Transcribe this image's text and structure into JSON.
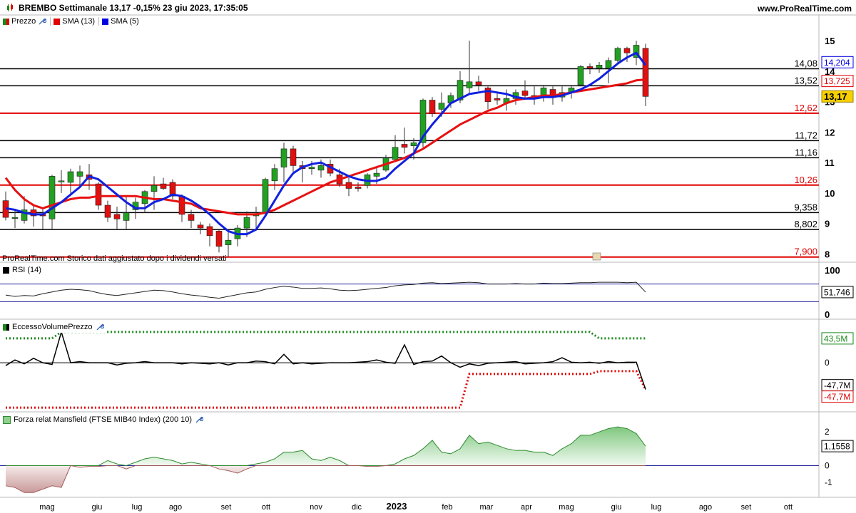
{
  "header": {
    "title": "BREMBO Settimanale 13,17 -0,15% 23 giu 2023, 17:35:05",
    "site": "www.ProRealTime.com"
  },
  "price_panel": {
    "legend": [
      {
        "label": "Prezzo",
        "color": "#1a8a1a"
      },
      {
        "label": "SMA (13)",
        "color": "#e00000"
      },
      {
        "label": "SMA (5)",
        "color": "#0000e0"
      }
    ],
    "caption": "ProRealTime.com  Storico dati aggiustato dopo i dividendi versati",
    "y_ticks": [
      "15",
      "14",
      "13",
      "12",
      "11",
      "10",
      "9",
      "8"
    ],
    "black_levels": [
      "14,08",
      "13,52",
      "11,72",
      "11,16",
      "9,358",
      "8,802"
    ],
    "red_levels": [
      "12,62",
      "10,26",
      "7,900"
    ],
    "sma5_badge": "14,204",
    "sma13_badge": "13,725",
    "last_price_badge": "13,17"
  },
  "rsi_panel": {
    "legend": "RSI (14)",
    "y_ticks": [
      "100",
      "0"
    ],
    "value_badge": "51,746"
  },
  "volume_panel": {
    "legend": "EccessoVolumePrezzo",
    "upper_badge": "43,5M",
    "zero_tick": "0",
    "lower_badge_black": "-47,7M",
    "lower_badge_red": "-47,7M"
  },
  "mansfield_panel": {
    "legend": "Forza relat Mansfield (FTSE MIB40 Index) (200 10)",
    "y_ticks": [
      "2",
      "0",
      "-1"
    ],
    "value_badge": "1,1558"
  },
  "x_axis": {
    "labels": [
      "mag",
      "giu",
      "lug",
      "ago",
      "set",
      "ott",
      "nov",
      "dic",
      "2023",
      "feb",
      "mar",
      "apr",
      "mag",
      "giu",
      "lug",
      "ago",
      "set",
      "ott"
    ]
  },
  "chart_data": {
    "type": "candlestick",
    "title": "BREMBO Settimanale",
    "period": "weekly",
    "candles": [
      {
        "o": 9.75,
        "h": 10.05,
        "l": 9.1,
        "c": 9.2
      },
      {
        "o": 9.2,
        "h": 9.45,
        "l": 8.85,
        "c": 9.2
      },
      {
        "o": 9.1,
        "h": 9.9,
        "l": 9.0,
        "c": 9.45
      },
      {
        "o": 9.45,
        "h": 9.65,
        "l": 8.9,
        "c": 9.25
      },
      {
        "o": 9.3,
        "h": 9.5,
        "l": 8.8,
        "c": 9.25
      },
      {
        "o": 9.15,
        "h": 10.6,
        "l": 8.8,
        "c": 10.55
      },
      {
        "o": 10.4,
        "h": 10.75,
        "l": 10.0,
        "c": 10.4
      },
      {
        "o": 10.35,
        "h": 10.8,
        "l": 9.9,
        "c": 10.7
      },
      {
        "o": 10.55,
        "h": 10.9,
        "l": 10.2,
        "c": 10.7
      },
      {
        "o": 10.6,
        "h": 10.95,
        "l": 10.1,
        "c": 10.45
      },
      {
        "o": 10.3,
        "h": 10.35,
        "l": 9.45,
        "c": 9.6
      },
      {
        "o": 9.6,
        "h": 9.75,
        "l": 9.05,
        "c": 9.2
      },
      {
        "o": 9.3,
        "h": 9.55,
        "l": 8.8,
        "c": 9.15
      },
      {
        "o": 9.1,
        "h": 9.9,
        "l": 8.8,
        "c": 9.35
      },
      {
        "o": 9.45,
        "h": 9.85,
        "l": 9.15,
        "c": 9.7
      },
      {
        "o": 9.65,
        "h": 10.1,
        "l": 9.35,
        "c": 10.05
      },
      {
        "o": 10.05,
        "h": 10.55,
        "l": 9.45,
        "c": 10.25
      },
      {
        "o": 10.3,
        "h": 10.5,
        "l": 10.1,
        "c": 10.15
      },
      {
        "o": 10.35,
        "h": 10.45,
        "l": 9.8,
        "c": 9.9
      },
      {
        "o": 9.9,
        "h": 9.95,
        "l": 9.05,
        "c": 9.3
      },
      {
        "o": 9.3,
        "h": 9.45,
        "l": 8.85,
        "c": 9.1
      },
      {
        "o": 8.95,
        "h": 9.05,
        "l": 8.65,
        "c": 8.85
      },
      {
        "o": 8.9,
        "h": 9.0,
        "l": 8.25,
        "c": 8.6
      },
      {
        "o": 8.75,
        "h": 8.8,
        "l": 8.05,
        "c": 8.25
      },
      {
        "o": 8.3,
        "h": 8.75,
        "l": 7.9,
        "c": 8.45
      },
      {
        "o": 8.5,
        "h": 8.95,
        "l": 8.25,
        "c": 8.85
      },
      {
        "o": 8.85,
        "h": 9.4,
        "l": 8.55,
        "c": 9.2
      },
      {
        "o": 9.25,
        "h": 9.55,
        "l": 8.85,
        "c": 9.3
      },
      {
        "o": 9.35,
        "h": 10.5,
        "l": 9.3,
        "c": 10.45
      },
      {
        "o": 10.4,
        "h": 10.95,
        "l": 10.1,
        "c": 10.8
      },
      {
        "o": 10.85,
        "h": 11.65,
        "l": 10.35,
        "c": 11.45
      },
      {
        "o": 11.45,
        "h": 11.55,
        "l": 10.7,
        "c": 10.9
      },
      {
        "o": 10.9,
        "h": 11.05,
        "l": 10.35,
        "c": 10.8
      },
      {
        "o": 10.8,
        "h": 11.05,
        "l": 10.6,
        "c": 10.85
      },
      {
        "o": 10.75,
        "h": 11.1,
        "l": 10.5,
        "c": 10.9
      },
      {
        "o": 10.95,
        "h": 11.1,
        "l": 10.55,
        "c": 10.65
      },
      {
        "o": 10.6,
        "h": 10.8,
        "l": 10.2,
        "c": 10.3
      },
      {
        "o": 10.35,
        "h": 10.5,
        "l": 9.9,
        "c": 10.15
      },
      {
        "o": 10.2,
        "h": 10.35,
        "l": 10.05,
        "c": 10.15
      },
      {
        "o": 10.25,
        "h": 10.65,
        "l": 10.15,
        "c": 10.6
      },
      {
        "o": 10.55,
        "h": 10.85,
        "l": 10.3,
        "c": 10.65
      },
      {
        "o": 10.75,
        "h": 11.25,
        "l": 10.7,
        "c": 11.15
      },
      {
        "o": 11.1,
        "h": 11.9,
        "l": 11.1,
        "c": 11.5
      },
      {
        "o": 11.6,
        "h": 12.15,
        "l": 11.3,
        "c": 11.5
      },
      {
        "o": 11.55,
        "h": 11.8,
        "l": 11.1,
        "c": 11.65
      },
      {
        "o": 11.65,
        "h": 13.1,
        "l": 11.5,
        "c": 13.05
      },
      {
        "o": 13.05,
        "h": 13.15,
        "l": 12.5,
        "c": 12.6
      },
      {
        "o": 12.75,
        "h": 13.3,
        "l": 12.5,
        "c": 12.95
      },
      {
        "o": 12.95,
        "h": 13.3,
        "l": 12.8,
        "c": 13.2
      },
      {
        "o": 13.05,
        "h": 14.0,
        "l": 12.95,
        "c": 13.7
      },
      {
        "o": 13.45,
        "h": 15.0,
        "l": 13.25,
        "c": 13.65
      },
      {
        "o": 13.65,
        "h": 13.85,
        "l": 13.35,
        "c": 13.55
      },
      {
        "o": 13.45,
        "h": 13.5,
        "l": 12.75,
        "c": 13.0
      },
      {
        "o": 13.1,
        "h": 13.3,
        "l": 12.9,
        "c": 13.05
      },
      {
        "o": 12.95,
        "h": 13.4,
        "l": 12.7,
        "c": 13.1
      },
      {
        "o": 13.1,
        "h": 13.4,
        "l": 12.9,
        "c": 13.3
      },
      {
        "o": 13.35,
        "h": 13.7,
        "l": 13.1,
        "c": 13.2
      },
      {
        "o": 13.2,
        "h": 13.5,
        "l": 12.9,
        "c": 13.1
      },
      {
        "o": 13.15,
        "h": 13.55,
        "l": 13.0,
        "c": 13.45
      },
      {
        "o": 13.4,
        "h": 13.5,
        "l": 12.9,
        "c": 13.15
      },
      {
        "o": 13.15,
        "h": 13.5,
        "l": 13.0,
        "c": 13.3
      },
      {
        "o": 13.3,
        "h": 13.55,
        "l": 13.1,
        "c": 13.45
      },
      {
        "o": 13.55,
        "h": 14.2,
        "l": 13.5,
        "c": 14.15
      },
      {
        "o": 14.15,
        "h": 14.25,
        "l": 13.9,
        "c": 14.1
      },
      {
        "o": 14.1,
        "h": 14.3,
        "l": 13.95,
        "c": 14.2
      },
      {
        "o": 14.1,
        "h": 14.45,
        "l": 13.6,
        "c": 14.35
      },
      {
        "o": 14.35,
        "h": 14.8,
        "l": 14.2,
        "c": 14.75
      },
      {
        "o": 14.75,
        "h": 14.8,
        "l": 14.3,
        "c": 14.6
      },
      {
        "o": 14.45,
        "h": 15.0,
        "l": 14.2,
        "c": 14.85
      },
      {
        "o": 14.75,
        "h": 14.9,
        "l": 12.85,
        "c": 13.17
      }
    ],
    "sma5": [
      9.5,
      9.45,
      9.35,
      9.3,
      9.3,
      9.5,
      9.7,
      9.95,
      10.2,
      10.55,
      10.45,
      10.2,
      9.95,
      9.7,
      9.5,
      9.5,
      9.7,
      9.8,
      9.95,
      9.9,
      9.75,
      9.55,
      9.3,
      9.0,
      8.75,
      8.65,
      8.65,
      8.8,
      9.25,
      9.75,
      10.25,
      10.65,
      10.85,
      10.95,
      11.0,
      10.85,
      10.7,
      10.55,
      10.45,
      10.4,
      10.4,
      10.5,
      10.8,
      11.05,
      11.3,
      11.85,
      12.25,
      12.6,
      12.95,
      13.1,
      13.25,
      13.3,
      13.35,
      13.3,
      13.25,
      13.15,
      13.1,
      13.1,
      13.15,
      13.15,
      13.2,
      13.3,
      13.4,
      13.55,
      13.75,
      14.0,
      14.25,
      14.45,
      14.6,
      14.2
    ],
    "sma13": [
      10.5,
      10.1,
      9.8,
      9.6,
      9.5,
      9.6,
      9.7,
      9.8,
      9.85,
      9.85,
      9.9,
      9.9,
      9.9,
      9.9,
      9.9,
      9.85,
      9.8,
      9.8,
      9.75,
      9.7,
      9.65,
      9.5,
      9.45,
      9.4,
      9.35,
      9.3,
      9.3,
      9.3,
      9.35,
      9.45,
      9.6,
      9.75,
      9.9,
      10.05,
      10.2,
      10.35,
      10.45,
      10.55,
      10.65,
      10.75,
      10.85,
      10.95,
      11.05,
      11.15,
      11.3,
      11.45,
      11.65,
      11.85,
      12.05,
      12.25,
      12.4,
      12.55,
      12.7,
      12.8,
      12.95,
      13.05,
      13.1,
      13.15,
      13.2,
      13.2,
      13.25,
      13.3,
      13.35,
      13.4,
      13.45,
      13.5,
      13.55,
      13.6,
      13.7,
      13.725
    ],
    "levels_black": [
      14.08,
      13.52,
      11.72,
      11.16,
      9.358,
      8.802
    ],
    "levels_red": [
      12.62,
      10.26,
      7.9
    ],
    "y_range": [
      7.8,
      15.4
    ],
    "rsi": {
      "range": [
        0,
        100
      ],
      "bands": [
        70,
        30
      ],
      "values": [
        45,
        42,
        44,
        43,
        48,
        52,
        56,
        58,
        57,
        55,
        50,
        46,
        44,
        47,
        50,
        53,
        56,
        55,
        52,
        48,
        45,
        43,
        40,
        38,
        42,
        46,
        50,
        52,
        58,
        62,
        65,
        63,
        60,
        60,
        61,
        59,
        56,
        55,
        56,
        58,
        60,
        62,
        66,
        68,
        69,
        72,
        73,
        71,
        72,
        73,
        74,
        73,
        70,
        70,
        70,
        71,
        70,
        70,
        72,
        71,
        71,
        72,
        73,
        73,
        74,
        74,
        74,
        73,
        74,
        51.746
      ]
    },
    "volume_excess": {
      "black_line": [
        -5,
        5,
        -2,
        8,
        0,
        -3,
        55,
        0,
        2,
        0,
        0,
        0,
        -4,
        -1,
        0,
        2,
        0,
        0,
        0,
        -2,
        0,
        -1,
        -2,
        0,
        -4,
        0,
        0,
        3,
        2,
        -2,
        15,
        -2,
        0,
        -2,
        -1,
        0,
        0,
        0,
        1,
        2,
        5,
        1,
        -1,
        32,
        -3,
        2,
        3,
        12,
        0,
        -8,
        -2,
        -5,
        -1,
        0,
        1,
        2,
        -2,
        -1,
        0,
        2,
        9,
        1,
        0,
        1,
        -1,
        2,
        0,
        1,
        1,
        -47.7
      ],
      "green_dotted": [
        43.5,
        43.5,
        43.5,
        43.5,
        43.5,
        43.5,
        55,
        55,
        55,
        55,
        55,
        55,
        55,
        55,
        55,
        55,
        55,
        55,
        55,
        55,
        55,
        55,
        55,
        55,
        55,
        55,
        55,
        55,
        55,
        55,
        55,
        55,
        55,
        55,
        55,
        55,
        55,
        55,
        55,
        55,
        55,
        55,
        55,
        55,
        55,
        55,
        55,
        55,
        55,
        55,
        55,
        55,
        55,
        55,
        55,
        55,
        55,
        55,
        55,
        55,
        55,
        55,
        55,
        55,
        43.5,
        43.5,
        43.5,
        43.5,
        43.5,
        43.5
      ],
      "red_dotted": [
        -80,
        -80,
        -80,
        -80,
        -80,
        -80,
        -80,
        -80,
        -80,
        -80,
        -80,
        -80,
        -80,
        -80,
        -80,
        -80,
        -80,
        -80,
        -80,
        -80,
        -80,
        -80,
        -80,
        -80,
        -80,
        -80,
        -80,
        -80,
        -80,
        -80,
        -80,
        -80,
        -80,
        -80,
        -80,
        -80,
        -80,
        -80,
        -80,
        -80,
        -80,
        -80,
        -80,
        -80,
        -80,
        -80,
        -80,
        -80,
        -80,
        -80,
        -20,
        -20,
        -20,
        -20,
        -20,
        -20,
        -20,
        -20,
        -20,
        -20,
        -20,
        -20,
        -20,
        -20,
        -15,
        -15,
        -15,
        -15,
        -15,
        -47.7
      ]
    },
    "mansfield": {
      "values": [
        -1.2,
        -1.3,
        -1.6,
        -1.6,
        -1.4,
        -1.2,
        -1.3,
        0.0,
        -0.1,
        -0.05,
        -0.05,
        0.3,
        0.1,
        -0.2,
        0.2,
        0.4,
        0.5,
        0.4,
        0.3,
        0.1,
        0.2,
        0.1,
        0.0,
        -0.2,
        -0.3,
        -0.45,
        -0.2,
        0.1,
        0.2,
        0.4,
        0.8,
        0.8,
        0.9,
        0.4,
        0.3,
        0.5,
        0.3,
        0.0,
        0.0,
        -0.05,
        -0.05,
        0.0,
        0.1,
        0.4,
        0.6,
        1.0,
        1.5,
        0.8,
        0.7,
        1.0,
        1.8,
        1.3,
        1.4,
        1.2,
        1.0,
        0.9,
        0.9,
        0.8,
        0.8,
        0.6,
        1.0,
        1.3,
        1.8,
        1.8,
        2.0,
        2.2,
        2.3,
        2.2,
        1.9,
        1.1558
      ],
      "range": [
        -1.8,
        2.6
      ]
    }
  }
}
